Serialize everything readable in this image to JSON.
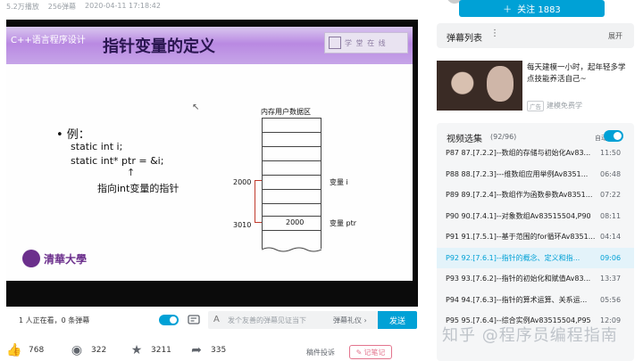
{
  "meta": {
    "plays": "5.2万播放",
    "danmaku_count": "256弹幕",
    "date": "2020-04-11 17:18:42"
  },
  "follow": {
    "label": "关注 1883"
  },
  "slide": {
    "course": "C++语言程序设计",
    "title": "指针变量的定义",
    "logo_text": "学 堂 在 线",
    "example_title": "• 例：",
    "line1": "static int i;",
    "line2": "static int*  ptr = &i;",
    "arrow": "↑",
    "note": "指向int变量的指针",
    "memory_title": "内存用户数据区",
    "addr1": "2000",
    "addr2": "3010",
    "cell_value": "2000",
    "var1": "变量 i",
    "var2": "变量 ptr",
    "university": "清華大學"
  },
  "player_bar": {
    "viewers": "1 人正在看，0 条弹幕",
    "input_placeholder": "发个友善的弹幕见证当下",
    "etiquette": "弹幕礼仪 ›",
    "send": "发送"
  },
  "actions": {
    "like": "768",
    "coin": "322",
    "favorite": "3211",
    "share": "335",
    "report": "稿件投诉",
    "notes": "记笔记"
  },
  "danmaku_list": {
    "title": "弹幕列表",
    "expand": "展开"
  },
  "ad": {
    "text": "每天建模一小时，起年轻多学点技能养活自己~",
    "tag": "广告",
    "source": "建模免费学"
  },
  "playlist": {
    "title": "视频选集",
    "count": "(92/96)",
    "autoplay": "自动连播",
    "items": [
      {
        "text": "P87  87.[7.2.2]--数组的存储与初始化Av83...",
        "duration": "11:50"
      },
      {
        "text": "P88  88.[7.2.3]---维数组应用举例Av8351...",
        "duration": "06:48"
      },
      {
        "text": "P89  89.[7.2.4]--数组作为函数参数Av8351...",
        "duration": "07:22"
      },
      {
        "text": "P90  90.[7.4.1]--对象数组Av83515504,P90",
        "duration": "08:11"
      },
      {
        "text": "P91  91.[7.5.1]--基于范围的for循环Av8351...",
        "duration": "04:14"
      },
      {
        "text": "P92  92.[7.6.1]--指针的概念、定义和指...",
        "duration": "09:06"
      },
      {
        "text": "P93  93.[7.6.2]--指针的初始化和赋值Av83...",
        "duration": "13:37"
      },
      {
        "text": "P94  94.[7.6.3]--指针的算术运算、关系运...",
        "duration": "05:56"
      },
      {
        "text": "P95  95.[7.6.4]--综合实例Av83515504,P95",
        "duration": "12:09"
      }
    ]
  },
  "watermark": "知乎 @程序员编程指南",
  "colors": {
    "accent": "#00a1d6",
    "slide_header": "#b989e2",
    "note_pink": "#e3748d"
  }
}
